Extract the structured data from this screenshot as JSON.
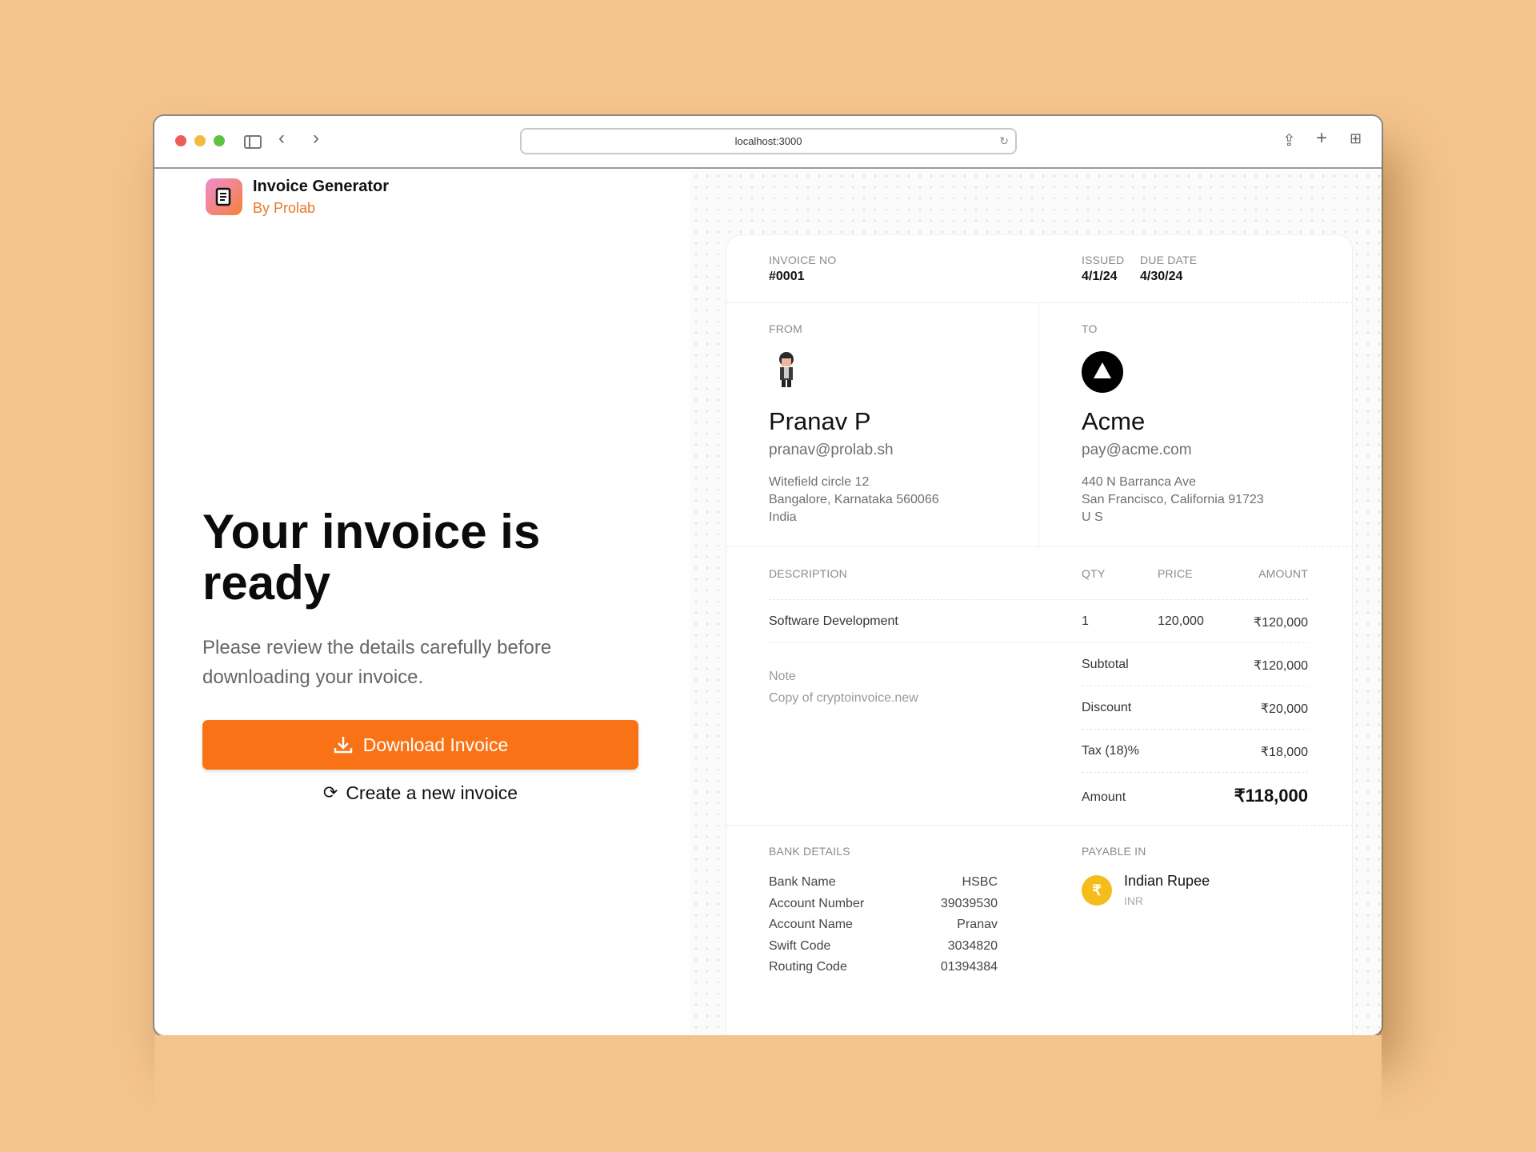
{
  "browser": {
    "url": "localhost:3000",
    "icons": [
      "sidebar-icon",
      "back-icon",
      "forward-icon",
      "reload-icon",
      "share-icon",
      "new-tab-icon",
      "tab-overview-icon"
    ]
  },
  "app": {
    "name": "Invoice Generator",
    "byline": "By Prolab"
  },
  "hero": {
    "title": "Your invoice is ready",
    "subtitle": "Please review the details carefully before downloading your invoice.",
    "download_label": "Download Invoice",
    "new_label": "Create a new invoice",
    "accent": "#f97316"
  },
  "invoice": {
    "no_label": "INVOICE NO",
    "no": "#0001",
    "issued_label": "ISSUED",
    "issued": "4/1/24",
    "due_label": "DUE DATE",
    "due": "4/30/24",
    "from": {
      "label": "FROM",
      "name": "Pranav P",
      "email": "pranav@prolab.sh",
      "address": [
        "Witefield circle 12",
        "Bangalore, Karnataka 560066",
        "India"
      ]
    },
    "to": {
      "label": "TO",
      "name": "Acme",
      "email": "pay@acme.com",
      "address": [
        "440 N Barranca Ave",
        "San Francisco, California 91723",
        "U S"
      ]
    },
    "columns": {
      "description": "DESCRIPTION",
      "qty": "QTY",
      "price": "PRICE",
      "amount": "AMOUNT"
    },
    "items": [
      {
        "description": "Software Development",
        "qty": "1",
        "price": "120,000",
        "amount": "₹120,000"
      }
    ],
    "note_label": "Note",
    "note": "Copy of cryptoinvoice.new",
    "totals": [
      {
        "label": "Subtotal",
        "value": "₹120,000"
      },
      {
        "label": "Discount",
        "value": "₹20,000"
      },
      {
        "label": "Tax (18)%",
        "value": "₹18,000"
      }
    ],
    "total": {
      "label": "Amount",
      "value": "₹118,000"
    },
    "bank": {
      "label": "BANK DETAILS",
      "rows": [
        {
          "k": "Bank Name",
          "v": "HSBC"
        },
        {
          "k": "Account Number",
          "v": "39039530"
        },
        {
          "k": "Account Name",
          "v": "Pranav"
        },
        {
          "k": "Swift Code",
          "v": "3034820"
        },
        {
          "k": "Routing Code",
          "v": "01394384"
        }
      ]
    },
    "payable": {
      "label": "PAYABLE IN",
      "currency": "Indian Rupee",
      "code": "INR",
      "symbol": "₹",
      "coin_color": "#f5bc1c"
    }
  }
}
